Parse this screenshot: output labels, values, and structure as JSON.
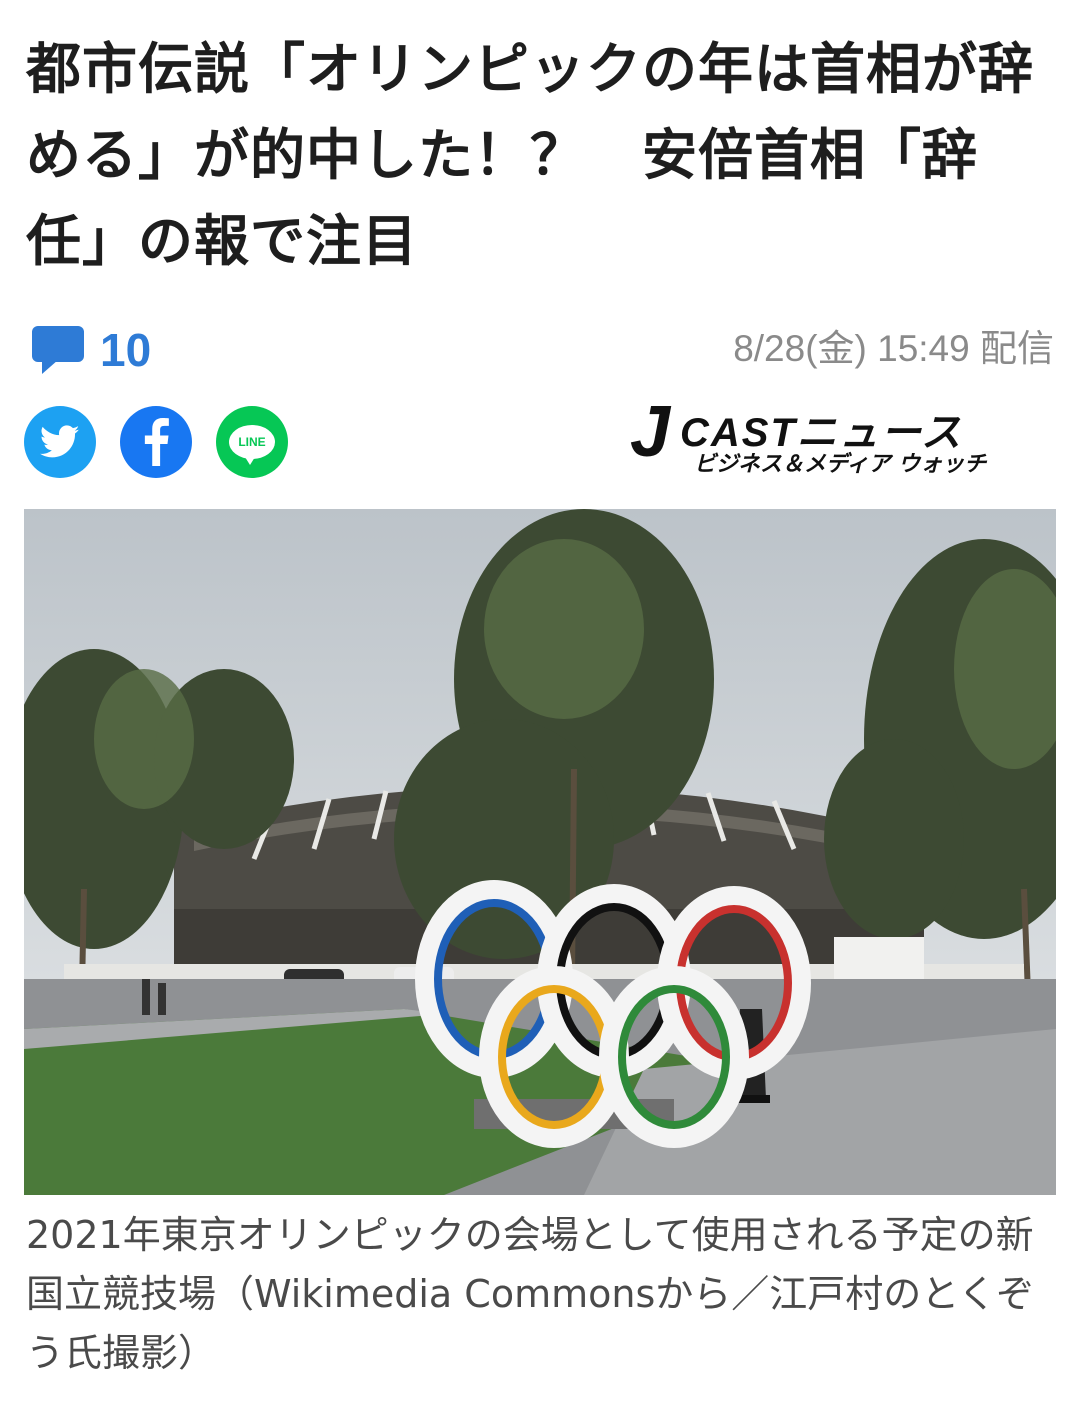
{
  "article": {
    "headline": "都市伝説「オリンピックの年は首相が辞める」が的中した！？　安倍首相「辞任」の報で注目",
    "comment_count": "10",
    "timestamp": "8/28(金) 15:49 配信"
  },
  "share": {
    "twitter_icon": "twitter-bird-icon",
    "facebook_icon": "facebook-f-icon",
    "line_label": "LINE"
  },
  "publisher": {
    "logo_j": "J",
    "logo_main": "CASTニュース",
    "logo_tagline": "ビジネス＆メディア ウォッチ"
  },
  "photo": {
    "subject": "olympic-rings-stadium-photo"
  },
  "caption": {
    "text": "2021年東京オリンピックの会場として使用される予定の新国立競技場（Wikimedia Commonsから／江戸村のとくぞう氏撮影）"
  },
  "colors": {
    "accent": "#2e7bd6",
    "twitter": "#1da1f2",
    "facebook": "#1877f2",
    "line": "#06c755"
  }
}
